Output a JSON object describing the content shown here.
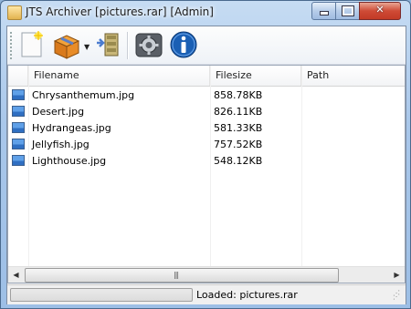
{
  "window": {
    "title": "JTS Archiver [pictures.rar] [Admin]"
  },
  "toolbar": {
    "buttons": [
      {
        "name": "new-archive",
        "icon": "new-document-icon"
      },
      {
        "name": "open-archive",
        "icon": "open-box-icon",
        "has_dropdown": true
      },
      {
        "name": "extract",
        "icon": "extract-icon"
      },
      {
        "name": "settings",
        "icon": "gear-icon"
      },
      {
        "name": "about",
        "icon": "info-icon"
      }
    ]
  },
  "list": {
    "columns": [
      "Filename",
      "Filesize",
      "Path"
    ],
    "rows": [
      {
        "filename": "Chrysanthemum.jpg",
        "filesize": "858.78KB",
        "path": "",
        "icon": "image-file-icon"
      },
      {
        "filename": "Desert.jpg",
        "filesize": "826.11KB",
        "path": "",
        "icon": "image-file-icon"
      },
      {
        "filename": "Hydrangeas.jpg",
        "filesize": "581.33KB",
        "path": "",
        "icon": "image-file-icon"
      },
      {
        "filename": "Jellyfish.jpg",
        "filesize": "757.52KB",
        "path": "",
        "icon": "image-file-icon"
      },
      {
        "filename": "Lighthouse.jpg",
        "filesize": "548.12KB",
        "path": "",
        "icon": "image-file-icon"
      }
    ]
  },
  "status": {
    "text": "Loaded: pictures.rar",
    "progress": 0
  },
  "colors": {
    "titlebar": "#b7d0ee",
    "close_button": "#cf4b36",
    "info_icon": "#1a5fb4"
  }
}
